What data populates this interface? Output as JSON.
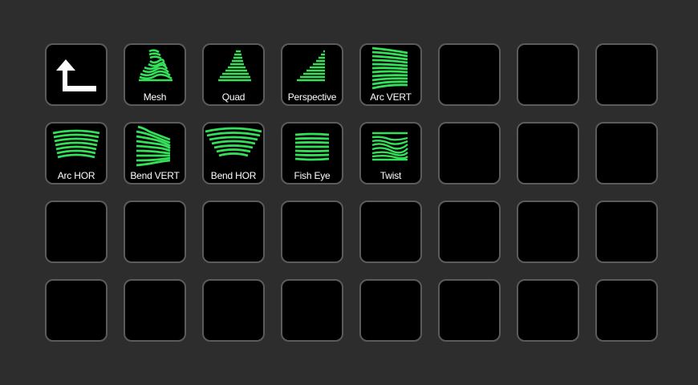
{
  "colors": {
    "background": "#2d2d2d",
    "key_fill": "#000000",
    "key_border": "#5b5b5b",
    "accent": "#34e05a",
    "label": "#ffffff"
  },
  "keys": [
    {
      "label": "",
      "icon": "back-arrow-icon"
    },
    {
      "label": "Mesh",
      "icon": "mesh-warp-icon"
    },
    {
      "label": "Quad",
      "icon": "quad-warp-icon"
    },
    {
      "label": "Perspective",
      "icon": "perspective-warp-icon"
    },
    {
      "label": "Arc VERT",
      "icon": "arc-vert-warp-icon"
    },
    {
      "label": "",
      "icon": ""
    },
    {
      "label": "",
      "icon": ""
    },
    {
      "label": "",
      "icon": ""
    },
    {
      "label": "Arc HOR",
      "icon": "arc-hor-warp-icon"
    },
    {
      "label": "Bend VERT",
      "icon": "bend-vert-warp-icon"
    },
    {
      "label": "Bend HOR",
      "icon": "bend-hor-warp-icon"
    },
    {
      "label": "Fish Eye",
      "icon": "fish-eye-warp-icon"
    },
    {
      "label": "Twist",
      "icon": "twist-warp-icon"
    },
    {
      "label": "",
      "icon": ""
    },
    {
      "label": "",
      "icon": ""
    },
    {
      "label": "",
      "icon": ""
    },
    {
      "label": "",
      "icon": ""
    },
    {
      "label": "",
      "icon": ""
    },
    {
      "label": "",
      "icon": ""
    },
    {
      "label": "",
      "icon": ""
    },
    {
      "label": "",
      "icon": ""
    },
    {
      "label": "",
      "icon": ""
    },
    {
      "label": "",
      "icon": ""
    },
    {
      "label": "",
      "icon": ""
    },
    {
      "label": "",
      "icon": ""
    },
    {
      "label": "",
      "icon": ""
    },
    {
      "label": "",
      "icon": ""
    },
    {
      "label": "",
      "icon": ""
    },
    {
      "label": "",
      "icon": ""
    },
    {
      "label": "",
      "icon": ""
    },
    {
      "label": "",
      "icon": ""
    },
    {
      "label": "",
      "icon": ""
    }
  ]
}
